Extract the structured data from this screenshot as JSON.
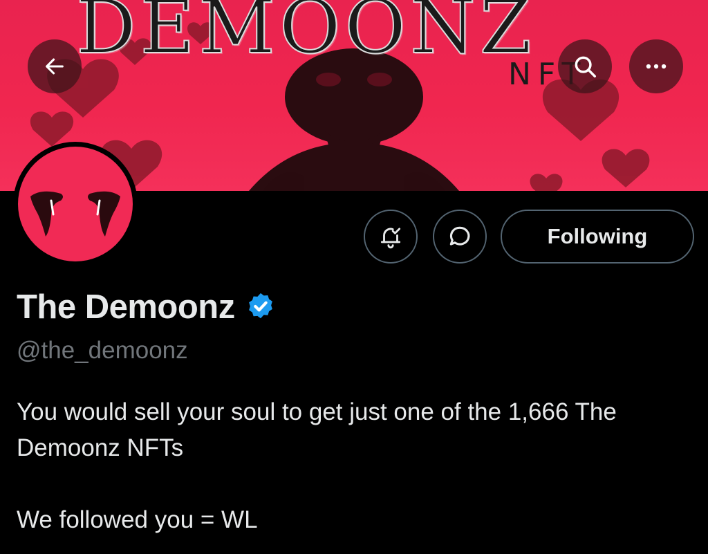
{
  "banner": {
    "title": "DEMOONZ",
    "subtitle": "NFT",
    "colors": {
      "background": "#f0264f",
      "art": "#2a0c10"
    }
  },
  "header": {
    "back_icon": "arrow-left-icon",
    "search_icon": "search-icon",
    "more_icon": "more-horizontal-icon"
  },
  "profile": {
    "display_name": "The Demoonz",
    "handle": "@the_demoonz",
    "verified": true,
    "verified_color": "#1d9bf0",
    "bio_line1": "You would sell your soul to get just one of the 1,666 The Demoonz NFTs",
    "bio_line2": "We followed you = WL"
  },
  "actions": {
    "notify_icon": "bell-check-icon",
    "message_icon": "message-bubble-icon",
    "following_label": "Following"
  }
}
